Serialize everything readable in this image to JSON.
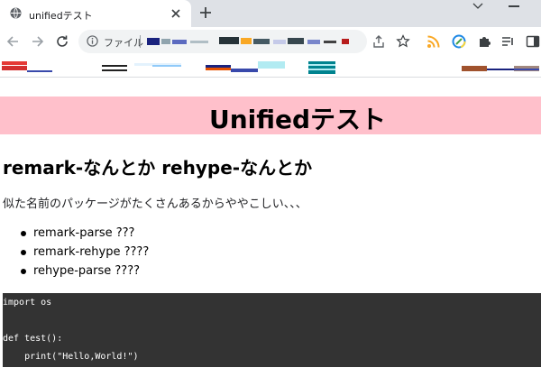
{
  "tabs": [
    {
      "title": "unifiedテスト",
      "active": true
    }
  ],
  "toolbar": {
    "scheme_label": "ファイル"
  },
  "page": {
    "banner_title": "Unifiedテスト",
    "banner_color": "#ffc0cb",
    "section_heading": "remark-なんとか rehype-なんとか",
    "intro": "似た名前のパッケージがたくさんあるからややこしい、、、",
    "packages": [
      "remark-parse ???",
      "remark-rehype ????",
      "rehype-parse ????"
    ],
    "code": {
      "background": "#333333",
      "lines": [
        "import os",
        "",
        "def test():",
        "    print(\"Hello,World!\")"
      ]
    }
  },
  "icons": {
    "tab_favicon": "globe-icon",
    "tab_close": "close-icon",
    "new_tab": "plus-icon",
    "back": "arrow-left-icon",
    "forward": "arrow-right-icon",
    "reload": "reload-icon",
    "site_info": "info-icon",
    "share": "share-icon",
    "bookmark": "star-icon",
    "extensions": [
      "rss-icon",
      "circle-check-icon",
      "puzzle-icon",
      "list-icon",
      "side-panel-icon"
    ]
  }
}
